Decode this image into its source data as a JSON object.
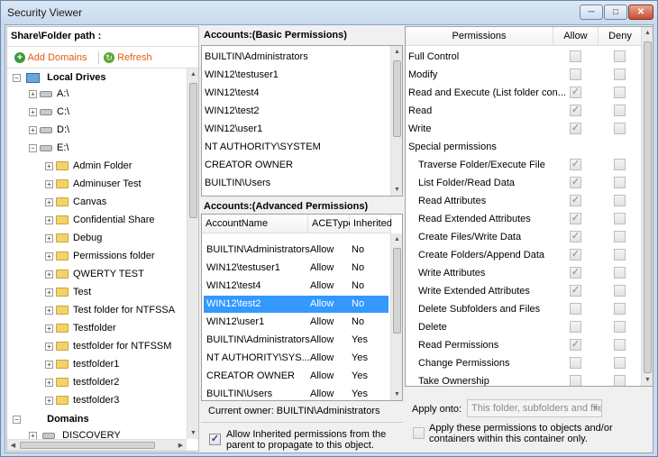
{
  "window": {
    "title": "Security Viewer",
    "min": "─",
    "max": "□",
    "close": "✕"
  },
  "tree": {
    "header": "Share\\Folder path :",
    "toolbar": {
      "add": "Add Domains",
      "refresh": "Refresh"
    },
    "local_drives": "Local Drives",
    "drives": [
      "A:\\",
      "C:\\",
      "D:\\",
      "E:\\"
    ],
    "folders": [
      "Admin Folder",
      "Adminuser Test",
      "Canvas",
      "Confidential Share",
      "Debug",
      "Permissions folder",
      "QWERTY TEST",
      "Test",
      "Test folder for NTFSSA",
      "Testfolder",
      "testfolder for NTFSSM",
      "testfolder1",
      "testfolder2",
      "testfolder3"
    ],
    "domains": "Domains",
    "discovery": "DISCOVERY"
  },
  "basic": {
    "header": "Accounts:(Basic Permissions)",
    "accounts": [
      "BUILTIN\\Administrators",
      "WIN12\\testuser1",
      "WIN12\\test4",
      "WIN12\\test2",
      "WIN12\\user1",
      "NT AUTHORITY\\SYSTEM",
      "CREATOR OWNER",
      "BUILTIN\\Users"
    ]
  },
  "advanced": {
    "header": "Accounts:(Advanced Permissions)",
    "columns": [
      "AccountName",
      "ACEType",
      "Inherited"
    ],
    "rows": [
      [
        "BUILTIN\\Administrators",
        "Allow",
        "No"
      ],
      [
        "WIN12\\testuser1",
        "Allow",
        "No"
      ],
      [
        "WIN12\\test4",
        "Allow",
        "No"
      ],
      [
        "WIN12\\test2",
        "Allow",
        "No"
      ],
      [
        "WIN12\\user1",
        "Allow",
        "No"
      ],
      [
        "BUILTIN\\Administrators",
        "Allow",
        "Yes"
      ],
      [
        "NT AUTHORITY\\SYS...",
        "Allow",
        "Yes"
      ],
      [
        "CREATOR OWNER",
        "Allow",
        "Yes"
      ],
      [
        "BUILTIN\\Users",
        "Allow",
        "Yes"
      ]
    ],
    "selected_index": 3,
    "owner": "Current owner: BUILTIN\\Administrators",
    "inherit_label": "Allow Inherited permissions from the parent to propagate to this object."
  },
  "perms": {
    "columns": [
      "Permissions",
      "Allow",
      "Deny"
    ],
    "rows": [
      {
        "name": "Full Control",
        "indent": false,
        "allow": false,
        "deny": false,
        "header": false
      },
      {
        "name": "Modify",
        "indent": false,
        "allow": false,
        "deny": false,
        "header": false
      },
      {
        "name": "Read and Execute (List folder con...",
        "indent": false,
        "allow": true,
        "deny": false,
        "header": false
      },
      {
        "name": "Read",
        "indent": false,
        "allow": true,
        "deny": false,
        "header": false
      },
      {
        "name": "Write",
        "indent": false,
        "allow": true,
        "deny": false,
        "header": false
      },
      {
        "name": "Special permissions",
        "indent": false,
        "allow": null,
        "deny": null,
        "header": true
      },
      {
        "name": "Traverse Folder/Execute File",
        "indent": true,
        "allow": true,
        "deny": false,
        "header": false
      },
      {
        "name": "List Folder/Read Data",
        "indent": true,
        "allow": true,
        "deny": false,
        "header": false
      },
      {
        "name": "Read Attributes",
        "indent": true,
        "allow": true,
        "deny": false,
        "header": false
      },
      {
        "name": "Read Extended Attributes",
        "indent": true,
        "allow": true,
        "deny": false,
        "header": false
      },
      {
        "name": "Create Files/Write Data",
        "indent": true,
        "allow": true,
        "deny": false,
        "header": false
      },
      {
        "name": "Create Folders/Append Data",
        "indent": true,
        "allow": true,
        "deny": false,
        "header": false
      },
      {
        "name": "Write Attributes",
        "indent": true,
        "allow": true,
        "deny": false,
        "header": false
      },
      {
        "name": "Write Extended Attributes",
        "indent": true,
        "allow": true,
        "deny": false,
        "header": false
      },
      {
        "name": "Delete Subfolders and Files",
        "indent": true,
        "allow": false,
        "deny": false,
        "header": false
      },
      {
        "name": "Delete",
        "indent": true,
        "allow": false,
        "deny": false,
        "header": false
      },
      {
        "name": "Read Permissions",
        "indent": true,
        "allow": true,
        "deny": false,
        "header": false
      },
      {
        "name": "Change Permissions",
        "indent": true,
        "allow": false,
        "deny": false,
        "header": false
      },
      {
        "name": "Take Ownership",
        "indent": true,
        "allow": false,
        "deny": false,
        "header": false
      }
    ],
    "apply_label": "Apply onto:",
    "apply_value": "This folder, subfolders and file",
    "apply_children_label": "Apply these permissions to objects and/or containers within this container only."
  },
  "colors": {
    "selection": "#3399ff",
    "title_bar": "#c6d9ed",
    "check": "#21478e"
  }
}
